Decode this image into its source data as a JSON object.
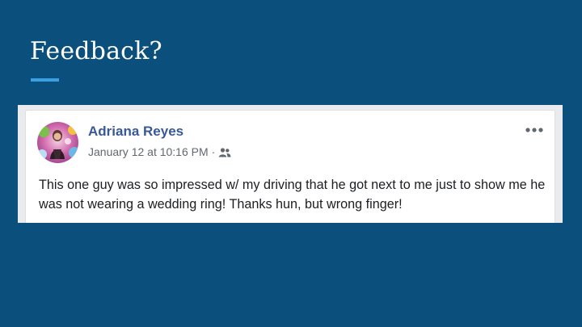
{
  "slide": {
    "title": "Feedback?"
  },
  "post": {
    "author": "Adriana Reyes",
    "timestamp": "January 12 at 10:16 PM",
    "separator": "·",
    "audience_icon": "friends-icon",
    "more_icon": "more-options-icon",
    "text": "This one guy was so impressed w/ my driving that he got next to me just to show me he was not wearing a wedding ring! Thanks hun, but wrong finger!"
  },
  "colors": {
    "slide_background": "#0b4f7c",
    "accent_underline": "#3aa0e4",
    "author_link": "#385898",
    "meta_text": "#616770",
    "body_text": "#1c1e21"
  }
}
